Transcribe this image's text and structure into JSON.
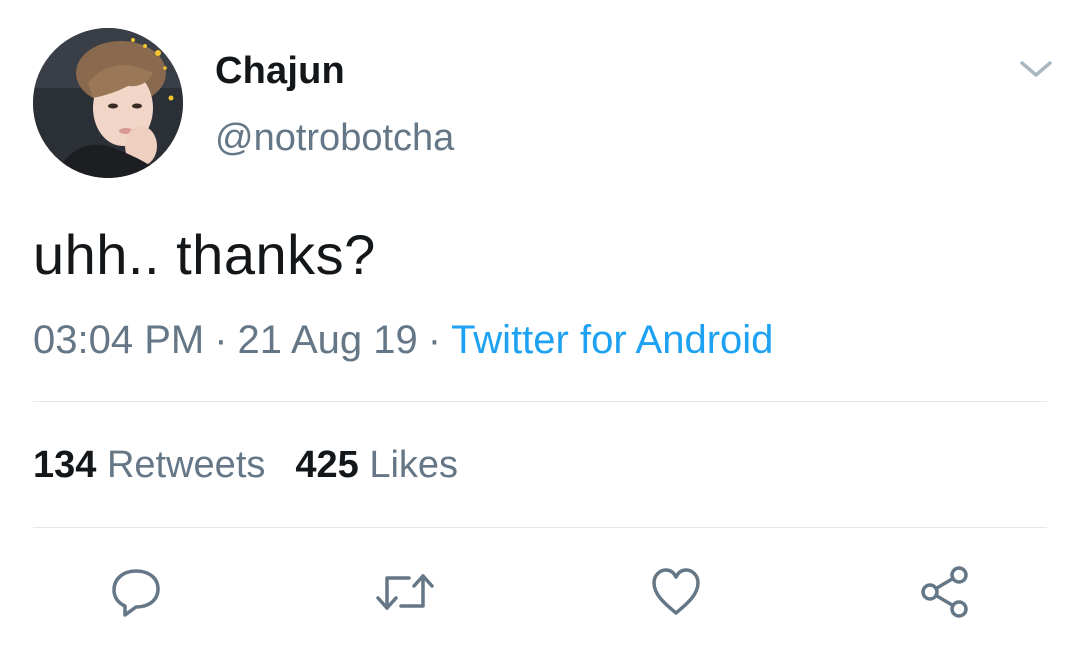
{
  "user": {
    "display_name": "Chajun",
    "handle": "@notrobotcha"
  },
  "tweet": {
    "text": "uhh.. thanks?",
    "time": "03:04 PM",
    "date": "21 Aug 19",
    "separator": "·",
    "source": "Twitter for Android"
  },
  "stats": {
    "retweets_count": "134",
    "retweets_label": "Retweets",
    "likes_count": "425",
    "likes_label": "Likes"
  },
  "icons": {
    "menu": "chevron-down-icon",
    "reply": "reply-icon",
    "retweet": "retweet-icon",
    "like": "heart-icon",
    "share": "share-icon"
  },
  "colors": {
    "primary_text": "#14171a",
    "secondary_text": "#657786",
    "link": "#1da1f2",
    "divider": "#e1e8ed"
  }
}
